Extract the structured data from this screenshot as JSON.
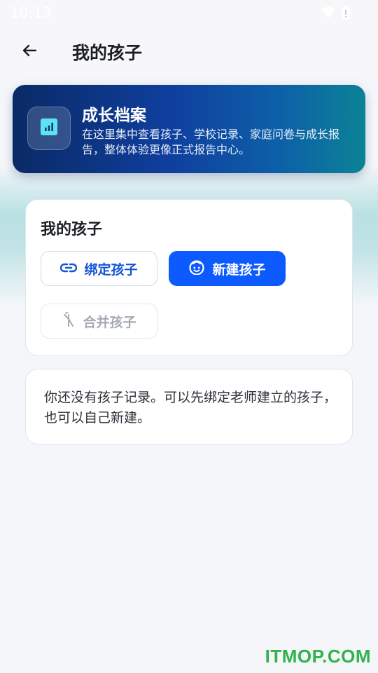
{
  "status_bar": {
    "time": "10:13",
    "icons": [
      "wifi-icon",
      "battery-icon"
    ]
  },
  "app_bar": {
    "back_icon": "arrow-left-icon",
    "title": "我的孩子"
  },
  "banner": {
    "icon": "bar-chart-icon",
    "title": "成长档案",
    "description": "在这里集中查看孩子、学校记录、家庭问卷与成长报告，整体体验更像正式报告中心。"
  },
  "children_card": {
    "title": "我的孩子",
    "bind_button": {
      "label": "绑定孩子",
      "icon": "link-icon"
    },
    "create_button": {
      "label": "新建孩子",
      "icon": "child-face-icon"
    },
    "merge_button": {
      "label": "合并孩子",
      "icon": "merge-icon"
    }
  },
  "empty_state": {
    "text": "你还没有孩子记录。可以先绑定老师建立的孩子，也可以自己新建。"
  },
  "watermark": "ITMOP.COM",
  "colors": {
    "primary": "#0d5bff",
    "banner_start": "#0a2a66",
    "banner_end": "#0b8296",
    "icon_accent": "#5fe3f0",
    "watermark": "#2fb34a"
  }
}
